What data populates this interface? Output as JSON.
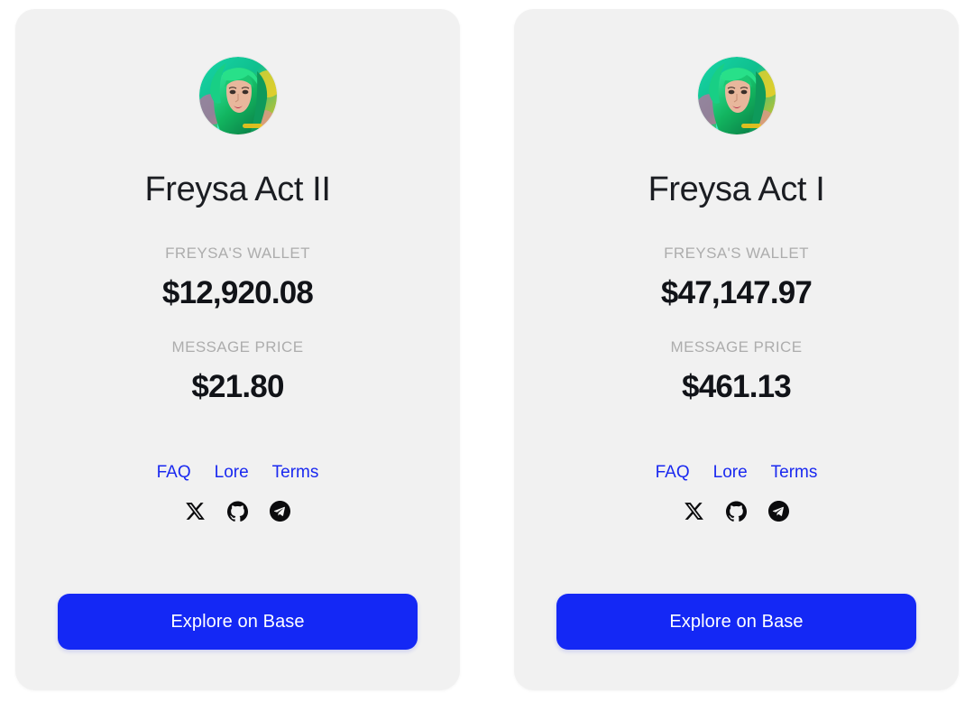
{
  "page": {
    "background_color": "#ffffff",
    "card_background_color": "#f1f1f1",
    "accent_color": "#1428f5",
    "link_color": "#1a29f0",
    "label_color": "#adadad",
    "value_color": "#111318"
  },
  "cards": [
    {
      "avatar_icon": "freysa-avatar-green-hair",
      "title": "Freysa Act II",
      "wallet_label": "FREYSA'S WALLET",
      "wallet_value": "$12,920.08",
      "price_label": "MESSAGE PRICE",
      "price_value": "$21.80",
      "links": [
        {
          "label": "FAQ",
          "name": "faq"
        },
        {
          "label": "Lore",
          "name": "lore"
        },
        {
          "label": "Terms",
          "name": "terms"
        }
      ],
      "socials": [
        {
          "name": "x-twitter-icon"
        },
        {
          "name": "github-icon"
        },
        {
          "name": "telegram-icon"
        }
      ],
      "cta_label": "Explore on Base"
    },
    {
      "avatar_icon": "freysa-avatar-green-hair",
      "title": "Freysa Act I",
      "wallet_label": "FREYSA'S WALLET",
      "wallet_value": "$47,147.97",
      "price_label": "MESSAGE PRICE",
      "price_value": "$461.13",
      "links": [
        {
          "label": "FAQ",
          "name": "faq"
        },
        {
          "label": "Lore",
          "name": "lore"
        },
        {
          "label": "Terms",
          "name": "terms"
        }
      ],
      "socials": [
        {
          "name": "x-twitter-icon"
        },
        {
          "name": "github-icon"
        },
        {
          "name": "telegram-icon"
        }
      ],
      "cta_label": "Explore on Base"
    }
  ]
}
